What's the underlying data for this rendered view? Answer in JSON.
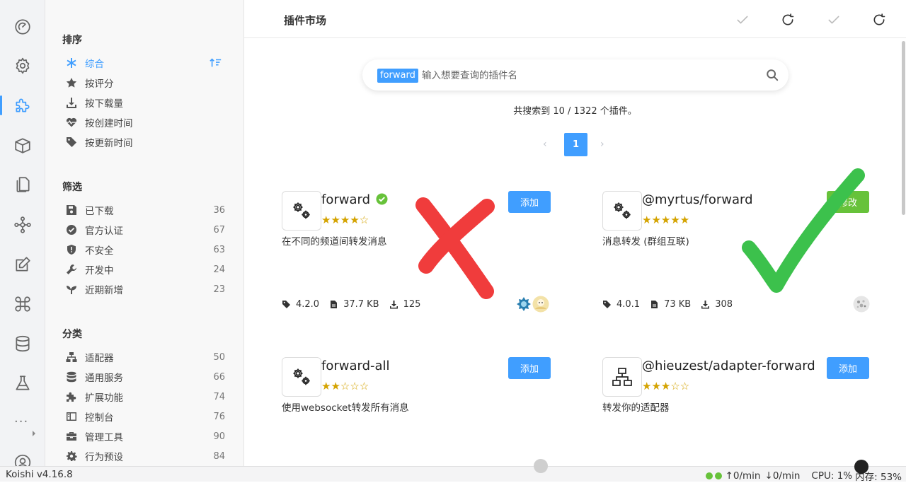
{
  "app": {
    "title": "插件市场",
    "version": "Koishi v4.16.8"
  },
  "activity": [
    "dashboard-icon",
    "settings-icon",
    "plugin-icon",
    "package-icon",
    "files-icon",
    "graph-icon",
    "edit-icon",
    "command-icon",
    "database-icon",
    "flask-icon",
    "more-icon",
    "user-icon"
  ],
  "sidebar": {
    "sort": {
      "title": "排序",
      "items": [
        {
          "label": "综合",
          "icon": "asterisk-icon",
          "active": true
        },
        {
          "label": "按评分",
          "icon": "star-icon"
        },
        {
          "label": "按下载量",
          "icon": "download-icon"
        },
        {
          "label": "按创建时间",
          "icon": "heartbeat-icon"
        },
        {
          "label": "按更新时间",
          "icon": "tag-icon"
        }
      ]
    },
    "filter": {
      "title": "筛选",
      "items": [
        {
          "label": "已下载",
          "count": "36",
          "icon": "save-icon"
        },
        {
          "label": "官方认证",
          "count": "67",
          "icon": "verified-icon"
        },
        {
          "label": "不安全",
          "count": "63",
          "icon": "shield-icon"
        },
        {
          "label": "开发中",
          "count": "24",
          "icon": "wrench-icon"
        },
        {
          "label": "近期新增",
          "count": "23",
          "icon": "seedling-icon"
        }
      ]
    },
    "category": {
      "title": "分类",
      "items": [
        {
          "label": "适配器",
          "count": "50",
          "icon": "network-icon"
        },
        {
          "label": "通用服务",
          "count": "66",
          "icon": "database-icon"
        },
        {
          "label": "扩展功能",
          "count": "74",
          "icon": "puzzle-icon"
        },
        {
          "label": "控制台",
          "count": "76",
          "icon": "window-icon"
        },
        {
          "label": "管理工具",
          "count": "90",
          "icon": "toolbox-icon"
        },
        {
          "label": "行为预设",
          "count": "84",
          "icon": "gear-icon"
        }
      ]
    }
  },
  "search": {
    "tag": "forward",
    "placeholder": "输入想要查询的插件名"
  },
  "results": {
    "text": "共搜索到 10 / 1322 个插件。"
  },
  "pager": {
    "prev": "‹",
    "current": "1",
    "next": "›"
  },
  "plugins": [
    {
      "name": "forward",
      "verified": true,
      "rating": 4,
      "stars": "★★★★☆",
      "desc": "在不同的频道间转发消息",
      "button": "添加",
      "version": "4.2.0",
      "size": "37.7 KB",
      "downloads": "125"
    },
    {
      "name": "@myrtus/forward",
      "verified": false,
      "rating": 5,
      "stars": "★★★★★",
      "desc": "消息转发 (群组互联)",
      "button": "修改",
      "version": "4.0.1",
      "size": "73 KB",
      "downloads": "308"
    },
    {
      "name": "forward-all",
      "verified": false,
      "rating": 2,
      "stars": "★★☆☆☆",
      "desc": "使用websocket转发所有消息",
      "button": "添加"
    },
    {
      "name": "@hieuzest/adapter-forward",
      "verified": false,
      "rating": 3,
      "stars": "★★★☆☆",
      "desc": "转发你的适配器",
      "button": "添加"
    }
  ],
  "status": {
    "upload": "0/min",
    "download": "0/min",
    "cpu": "CPU: 1%",
    "mem": "内存: 53%"
  },
  "colors": {
    "accent": "#409eff",
    "success": "#67c23a",
    "star": "#d4a300",
    "cross": "#f03c3c",
    "check": "#3cc14c"
  }
}
